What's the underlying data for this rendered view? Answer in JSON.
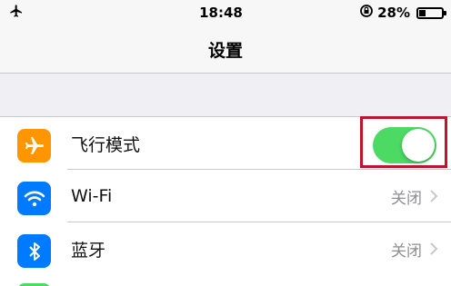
{
  "status_bar": {
    "time": "18:48",
    "battery_percent_label": "28%",
    "battery_level": 0.28
  },
  "nav": {
    "title": "设置"
  },
  "settings": [
    {
      "label": "飞行模式",
      "icon": "airplane-icon",
      "icon_color": "#ff9500",
      "toggle_on": true
    },
    {
      "label": "Wi-Fi",
      "icon": "wifi-icon",
      "icon_color": "#007aff",
      "value": "关闭"
    },
    {
      "label": "蓝牙",
      "icon": "bluetooth-icon",
      "icon_color": "#007aff",
      "value": "关闭"
    }
  ],
  "colors": {
    "toggle_on": "#4cd964",
    "highlight_box": "#c0142d"
  }
}
